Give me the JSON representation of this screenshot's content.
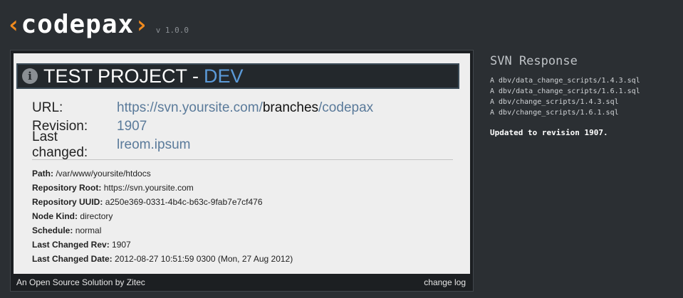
{
  "logo": {
    "left_bracket": "‹",
    "name": "codepax",
    "right_bracket": "›",
    "version": "v 1.0.0"
  },
  "project": {
    "name": "TEST PROJECT",
    "separator": "-",
    "environment": "DEV",
    "info_icon": "info-icon"
  },
  "summary": {
    "url_label": "URL:",
    "url_prefix": "https://svn.yoursite.com/",
    "url_branch": "branches",
    "url_suffix": "/codepax",
    "revision_label": "Revision:",
    "revision_value": "1907",
    "changed_label": "Last changed:",
    "changed_value": "lreom.ipsum"
  },
  "details": [
    {
      "label": "Path:",
      "value": "/var/www/yoursite/htdocs"
    },
    {
      "label": "Repository Root:",
      "value": "https://svn.yoursite.com"
    },
    {
      "label": "Repository UUID:",
      "value": "a250e369-0331-4b4c-b63c-9fab7e7cf476"
    },
    {
      "label": "Node Kind:",
      "value": "directory"
    },
    {
      "label": "Schedule:",
      "value": "normal"
    },
    {
      "label": "Last Changed Rev:",
      "value": "1907"
    },
    {
      "label": "Last Changed Date:",
      "value": "2012-08-27 10:51:59 0300 (Mon, 27 Aug 2012)"
    }
  ],
  "footer": {
    "credit": "An Open Source Solution by Zitec",
    "changelog": "change log"
  },
  "svn_response": {
    "title": "SVN Response",
    "lines": [
      "A dbv/data_change_scripts/1.4.3.sql",
      "A dbv/data_change_scripts/1.6.1.sql",
      "A dbv/change_scripts/1.4.3.sql",
      "A dbv/change_scripts/1.6.1.sql"
    ],
    "result": "Updated to revision 1907."
  },
  "colors": {
    "background": "#2b2f33",
    "accent_orange": "#f08a1e",
    "link_blue": "#5b9ad8"
  }
}
